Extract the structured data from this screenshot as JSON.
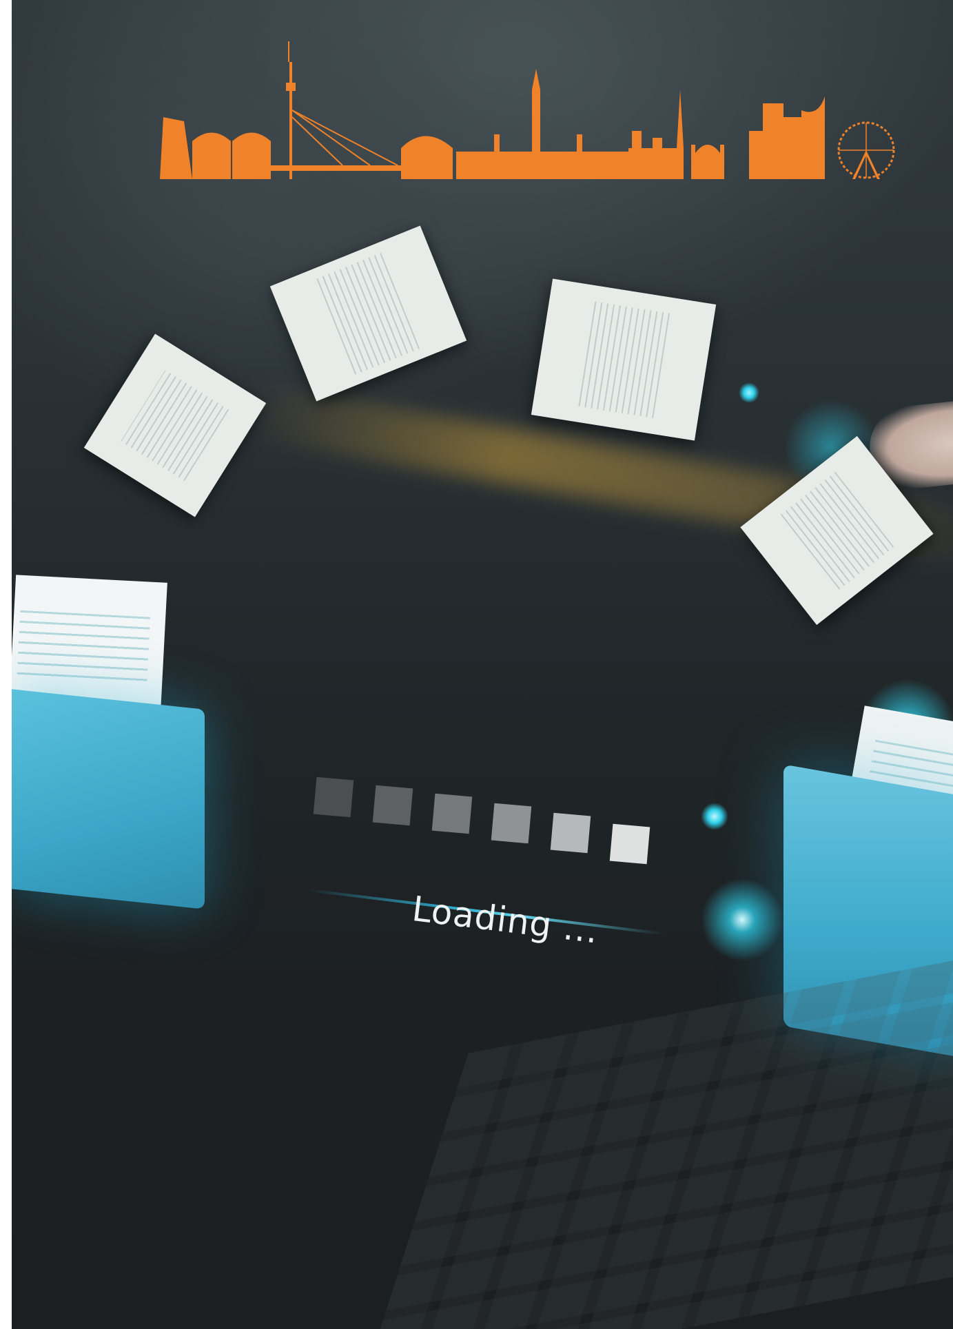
{
  "loading_text": "Loading ...",
  "colors": {
    "background_dark": "#1c1f20",
    "folder_blue": "#3ba6c7",
    "glow_cyan": "#2fd0ea",
    "skyline_orange": "#f0822a",
    "document_white": "#e8ece9"
  },
  "progress": {
    "segments_total": 6,
    "segment_shades": [
      "#4b4f51",
      "#5d6163",
      "#75797b",
      "#8f9395",
      "#b6b9ba",
      "#dfe1e1"
    ]
  },
  "icons": [
    "document-icon",
    "folder-icon",
    "loading-indicator",
    "skyline-icon"
  ]
}
